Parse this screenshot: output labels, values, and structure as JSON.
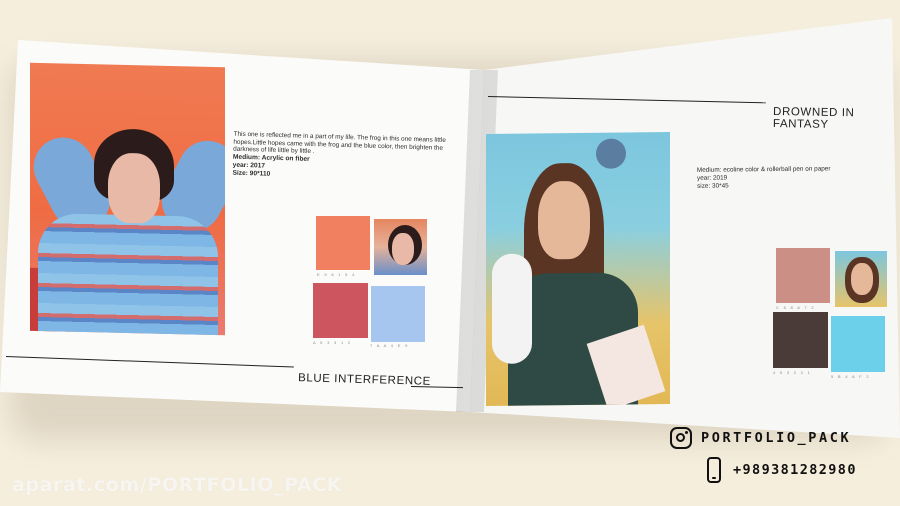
{
  "left_page": {
    "title": "BLUE INTERFERENCE",
    "description": "This one is reflected me in a part of my life. The frog in this one means little hopes.Little hopes came with the frog and the blue color, then brighten the darkness of life little by little .",
    "medium": "Medium: Acrylic on fiber",
    "year": "year: 2017",
    "size": "Size:  90*110",
    "swatch_labels": [
      "E 9 8 1 5 4",
      "A 5 3 3 1 2",
      "7 A A 4 E 9"
    ],
    "swatch_colors": [
      "#f08060",
      "#cc5560",
      "#a6c6ef"
    ]
  },
  "right_page": {
    "title": "DROWNED IN FANTASY",
    "medium": "Medium: ecoline color & rollerball pen on paper",
    "year": "year: 2019",
    "size": "size: 30*45",
    "swatch_labels": [
      "C 5 8 A 7 2",
      "4 5 3 2 2 1",
      "5 B 4 A F 2"
    ],
    "swatch_colors": [
      "#cc8f86",
      "#4a3a38",
      "#6cd0ea"
    ]
  },
  "overlay": {
    "watermark": "aparat.com/PORTFOLIO_PACK",
    "instagram_handle": "PORTFOLIO_PACK",
    "phone": "+989381282980"
  },
  "icons": [
    "instagram-icon",
    "phone-icon"
  ]
}
